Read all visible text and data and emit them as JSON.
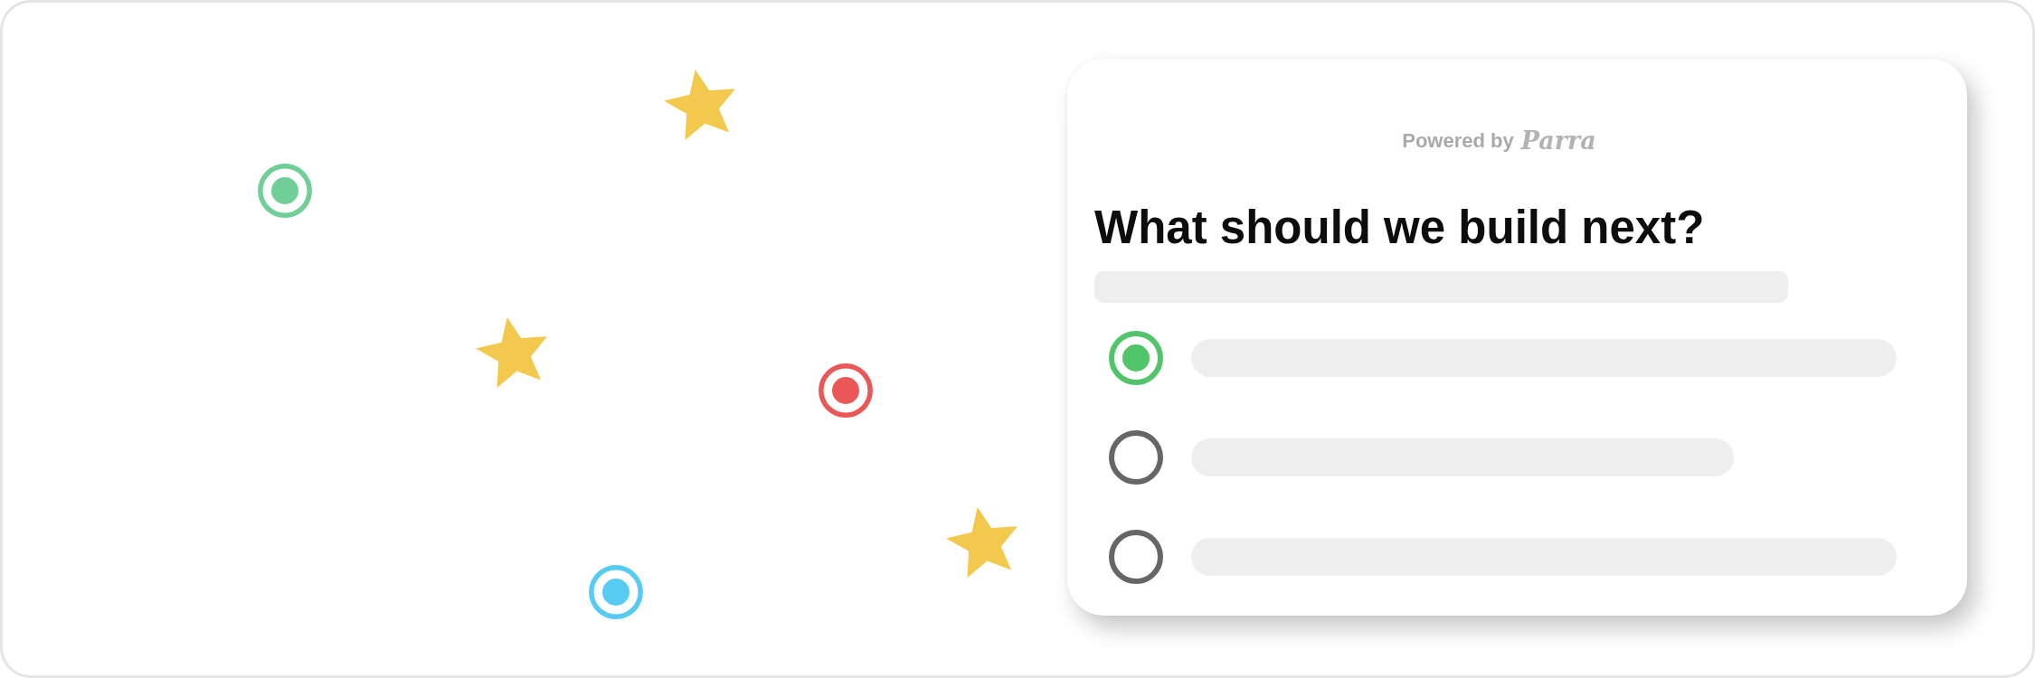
{
  "decorations": [
    {
      "kind": "star",
      "color": "#f2c94c"
    },
    {
      "kind": "target",
      "color": "#6fcf97"
    },
    {
      "kind": "star",
      "color": "#f2c94c"
    },
    {
      "kind": "target",
      "color": "#eb5757"
    },
    {
      "kind": "star",
      "color": "#f2c94c"
    },
    {
      "kind": "target",
      "color": "#56ccf2"
    }
  ],
  "survey_card": {
    "powered_by": {
      "label": "Powered by",
      "brand": "Parra"
    },
    "title": "What should we build next?",
    "description_skeleton": true,
    "options": [
      {
        "selected": true
      },
      {
        "selected": false
      },
      {
        "selected": false
      }
    ]
  }
}
